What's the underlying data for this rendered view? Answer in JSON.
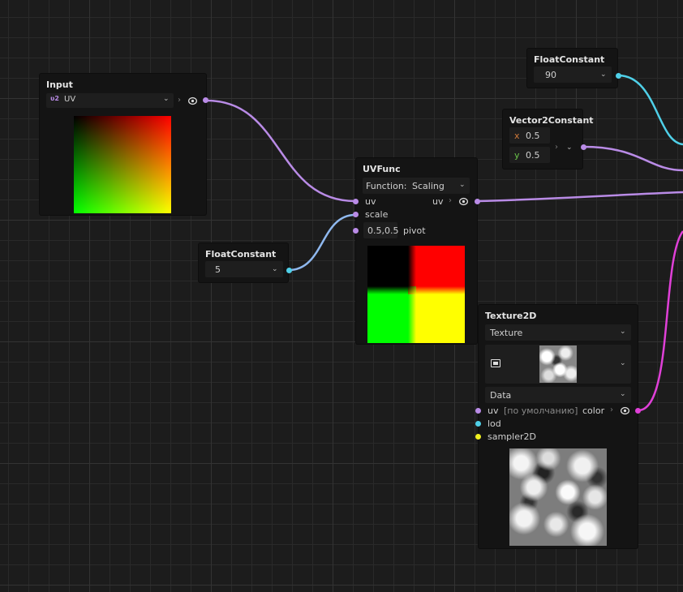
{
  "colors": {
    "uv_port": "#b98be6",
    "float_port": "#4fd0e8",
    "color_port": "#e040d8",
    "sampler_port": "#f0f020",
    "wire_uv": "#b98be6",
    "wire_float": "#4fd0e8",
    "wire_color": "#e040d8"
  },
  "nodes": {
    "input": {
      "title": "Input",
      "type_badge": "ₙv2",
      "type_value": "UV"
    },
    "float_90": {
      "title": "FloatConstant",
      "value": "90"
    },
    "vec2": {
      "title": "Vector2Constant",
      "x_label": "x",
      "x_value": "0.5",
      "y_label": "y",
      "y_value": "0.5"
    },
    "uvfunc": {
      "title": "UVFunc",
      "function_label": "Function:",
      "function_value": "Scaling",
      "port_uv_in": "uv",
      "port_uv_out": "uv",
      "port_scale": "scale",
      "pivot_value": "0.5,0.5",
      "pivot_label": "pivot"
    },
    "float_5": {
      "title": "FloatConstant",
      "value": "5"
    },
    "texture": {
      "title": "Texture2D",
      "texture_label": "Texture",
      "data_label": "Data",
      "port_uv": "uv",
      "port_uv_default": "[по умолчанию]",
      "port_color": "color",
      "port_lod": "lod",
      "port_sampler": "sampler2D"
    }
  }
}
